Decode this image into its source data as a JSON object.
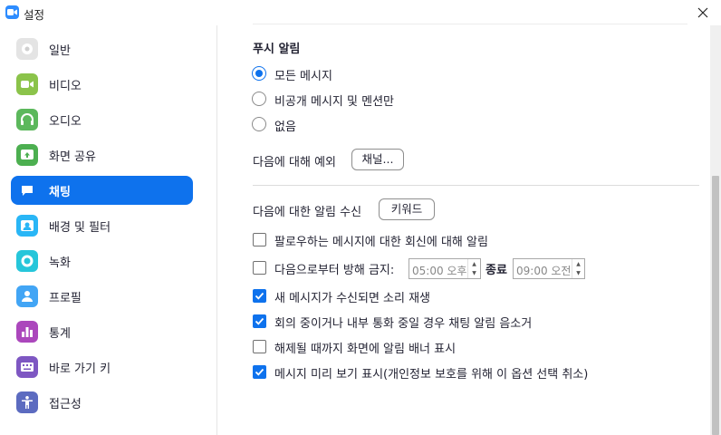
{
  "window": {
    "title": "설정"
  },
  "sidebar": {
    "items": [
      {
        "label": "일반",
        "icon": "gear-icon",
        "color": "#e4e4e4"
      },
      {
        "label": "비디오",
        "icon": "video-icon",
        "color": "#8bc34a"
      },
      {
        "label": "오디오",
        "icon": "headphones-icon",
        "color": "#5cb85c"
      },
      {
        "label": "화면 공유",
        "icon": "share-screen-icon",
        "color": "#4caf50"
      },
      {
        "label": "채팅",
        "icon": "chat-icon",
        "color": "#0e72ed",
        "active": true
      },
      {
        "label": "배경 및 필터",
        "icon": "background-icon",
        "color": "#29b6f6"
      },
      {
        "label": "녹화",
        "icon": "record-icon",
        "color": "#26c6da"
      },
      {
        "label": "프로필",
        "icon": "profile-icon",
        "color": "#42a5f5"
      },
      {
        "label": "통계",
        "icon": "statistics-icon",
        "color": "#ab47bc"
      },
      {
        "label": "바로 가기 키",
        "icon": "keyboard-icon",
        "color": "#7e57c2"
      },
      {
        "label": "접근성",
        "icon": "accessibility-icon",
        "color": "#5c6bc0"
      }
    ]
  },
  "push": {
    "title": "푸시 알림",
    "options": [
      {
        "label": "모든 메시지",
        "checked": true
      },
      {
        "label": "비공개 메시지 및 멘션만",
        "checked": false
      },
      {
        "label": "없음",
        "checked": false
      }
    ],
    "exception_label": "다음에 대해 예외",
    "channel_button": "채널..."
  },
  "keyword": {
    "label": "다음에 대한 알림 수신",
    "button": "키워드"
  },
  "checks": {
    "follow": {
      "label": "팔로우하는 메시지에 대한 회신에 대해 알림",
      "checked": false
    },
    "dnd": {
      "label": "다음으로부터 방해 금지:",
      "checked": false,
      "from": "05:00 오후",
      "end_label": "종료",
      "to": "09:00 오전"
    },
    "sound": {
      "label": "새 메시지가 수신되면 소리 재생",
      "checked": true
    },
    "mute_meeting": {
      "label": "회의 중이거나 내부 통화 중일 경우 채팅 알림 음소거",
      "checked": true
    },
    "banner": {
      "label": "해제될 때까지 화면에 알림 배너 표시",
      "checked": false
    },
    "preview": {
      "label": "메시지 미리 보기 표시(개인정보 보호를 위해 이 옵션 선택 취소)",
      "checked": true
    }
  }
}
